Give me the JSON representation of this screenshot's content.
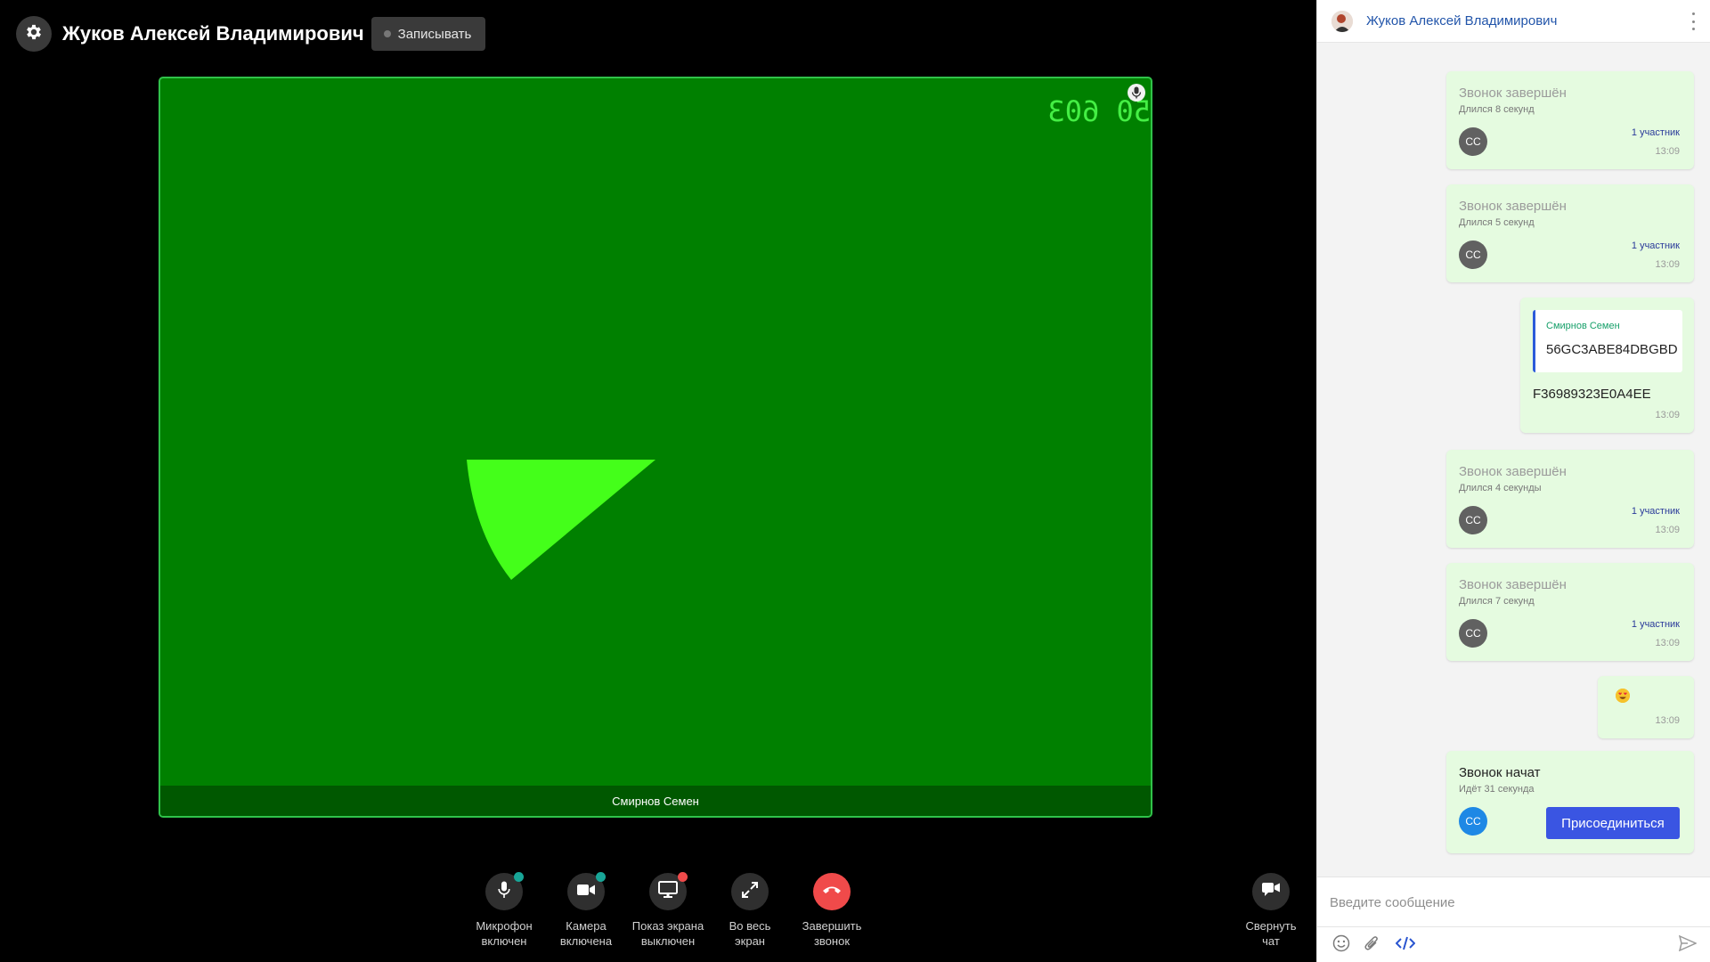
{
  "header": {
    "title": "Жуков Алексей Владимирович",
    "record_label": "Записывать"
  },
  "video": {
    "timecode": "50 603",
    "participant_label": "Смирнов Семен"
  },
  "controls": [
    {
      "label": "Микрофон\nвключен",
      "icon": "microphone-icon",
      "status": "green"
    },
    {
      "label": "Камера\nвключена",
      "icon": "camera-icon",
      "status": "green"
    },
    {
      "label": "Показ экрана\nвыключен",
      "icon": "screen-share-icon",
      "status": "red"
    },
    {
      "label": "Во весь\nэкран",
      "icon": "fullscreen-icon"
    },
    {
      "label": "Завершить\nзвонок",
      "icon": "hangup-icon"
    }
  ],
  "collapse_chat_label": "Свернуть\nчат",
  "chat": {
    "contact_name": "Жуков Алексей Владимирович",
    "messages": [
      {
        "type": "call_ended",
        "title": "Звонок завершён",
        "duration": "Длился 8 секунд",
        "avatar": "СС",
        "participants": "1 участник",
        "time": "13:09"
      },
      {
        "type": "call_ended",
        "title": "Звонок завершён",
        "duration": "Длился 5 секунд",
        "avatar": "СС",
        "participants": "1 участник",
        "time": "13:09"
      },
      {
        "type": "reply",
        "quote_author": "Смирнов Семен",
        "quote_text": "56GC3ABE84DBGBD",
        "text": "F36989323E0A4EE",
        "time": "13:09"
      },
      {
        "type": "call_ended",
        "title": "Звонок завершён",
        "duration": "Длился 4 секунды",
        "avatar": "СС",
        "participants": "1 участник",
        "time": "13:09"
      },
      {
        "type": "call_ended",
        "title": "Звонок завершён",
        "duration": "Длился 7 секунд",
        "avatar": "СС",
        "participants": "1 участник",
        "time": "13:09"
      },
      {
        "type": "emoji",
        "emoji": "heart-eyes-emoji",
        "time": "13:09"
      },
      {
        "type": "call_started",
        "title": "Звонок начат",
        "duration": "Идёт 31 секунда",
        "avatar": "СС",
        "join_label": "Присоединиться"
      }
    ],
    "input_placeholder": "Введите сообщение"
  },
  "colors": {
    "video_bg": "#008000",
    "video_border": "#30c24a",
    "accent": "#3a55e2",
    "message_bg": "#e5fbe0",
    "hangup": "#f04a4a"
  }
}
